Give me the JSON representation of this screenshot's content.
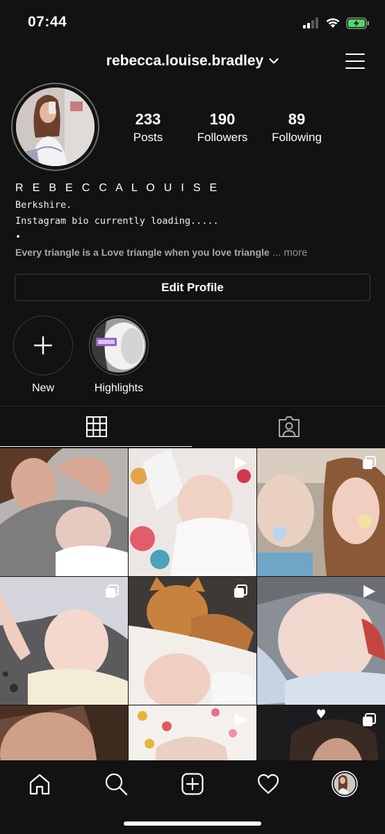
{
  "status_bar": {
    "time": "07:44"
  },
  "header": {
    "username": "rebecca.louise.bradley"
  },
  "profile": {
    "stats": [
      {
        "count": "233",
        "label": "Posts"
      },
      {
        "count": "190",
        "label": "Followers"
      },
      {
        "count": "89",
        "label": "Following"
      }
    ],
    "display_name": "R E B E C C A  L O U I S E",
    "bio_lines": [
      "Berkshire.",
      "Instagram bio currently loading.....",
      "•"
    ],
    "bio_truncated": "Every triangle is a Love triangle when you love triangle",
    "bio_more": "... more",
    "edit_button": "Edit Profile"
  },
  "highlights": [
    {
      "label": "New"
    },
    {
      "label": "Highlights"
    }
  ],
  "colors": {
    "background": "#121212",
    "text": "#ffffff",
    "muted": "#8e8e8e",
    "border": "#3b3b3b",
    "battery_green": "#4cd964"
  },
  "icons": {
    "grid_tab": "grid-icon",
    "tagged_tab": "tagged-icon",
    "nav": [
      "home-icon",
      "search-icon",
      "add-post-icon",
      "heart-icon",
      "profile-avatar"
    ]
  }
}
